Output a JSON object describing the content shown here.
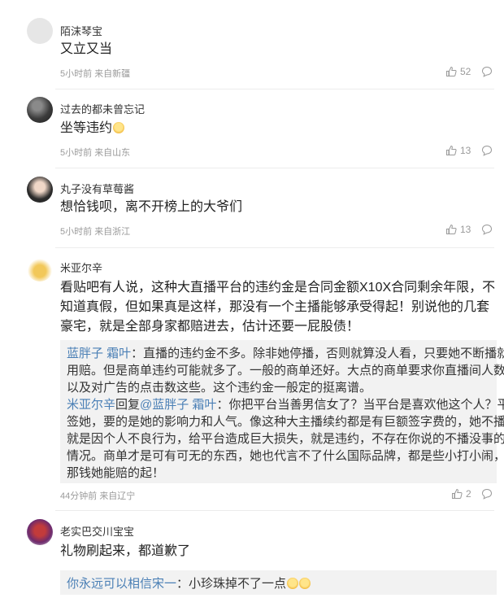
{
  "comments": [
    {
      "username": "陌沫琴宝",
      "text": "又立又当",
      "time": "5小时前",
      "location": "来自新疆",
      "likes": "52"
    },
    {
      "username": "过去的都未曾忘记",
      "text": "坐等违约",
      "time": "5小时前",
      "location": "来自山东",
      "likes": "13"
    },
    {
      "username": "丸子没有草莓酱",
      "text": "想恰钱呗，离不开榜上的大爷们",
      "time": "5小时前",
      "location": "来自浙江",
      "likes": "13"
    },
    {
      "username": "米亚尔辛",
      "text_lines": [
        "看贴吧有人说，这种大直播平台的违约金是合同金额X10X合同剩余年限，不",
        "知道真假，但如果真是这样，那没有一个主播能够承受得起！别说他的几套",
        "豪宅，就是全部身家都赔进去，估计还要一屁股债！"
      ],
      "replies": [
        {
          "user": "蓝胖子 霜叶",
          "lines": [
            "：直播的违约金不多。除非她停播，否则就算没人看，只要她不断播就不",
            "用赔。但是商单违约可能就多了。一般的商单还好。大点的商单要求你直播间人数",
            "以及对广告的点击数这些。这个违约金一般定的挺离谱。"
          ]
        },
        {
          "user": "米亚尔辛",
          "reply_word": "回复",
          "target": "@蓝胖子 霜叶",
          "lines": [
            "：你把平台当善男信女了？当平台是喜欢他这个人？平台",
            "签她，要的是她的影响力和人气。像这种大主播续约都是有巨额签字费的，她不播",
            "就是因个人不良行为，给平台造成巨大损失，就是违约，不存在你说的不播没事的",
            "情况。商单才是可有可无的东西，她也代言不了什么国际品牌，都是些小打小闹，",
            "那钱她能赔的起！"
          ]
        }
      ],
      "time": "44分钟前",
      "location": "来自辽宁",
      "likes": "2"
    },
    {
      "username": "老实巴交川宝宝",
      "text": "礼物刷起来，都道歉了",
      "replies": [
        {
          "user": "你永远可以相信宋一",
          "text": "：小珍珠掉不了一点"
        }
      ]
    }
  ]
}
